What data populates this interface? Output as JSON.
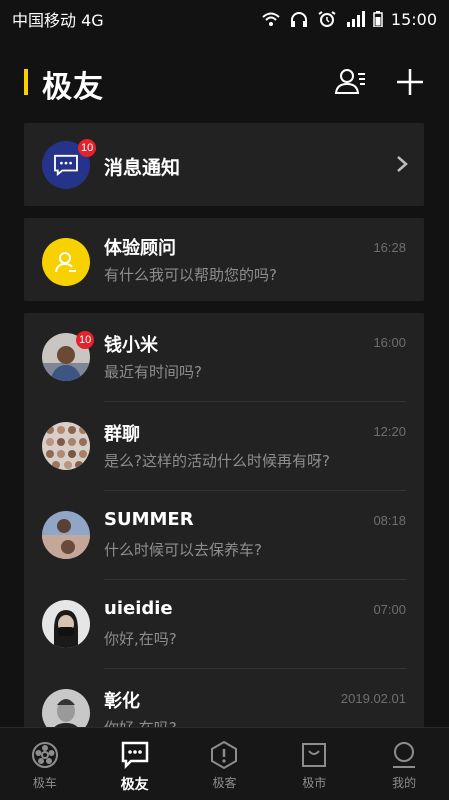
{
  "status_bar": {
    "carrier": "中国移动 4G",
    "time": "15:00"
  },
  "header": {
    "title": "极友",
    "accent_color": "#f7d100"
  },
  "notification": {
    "label": "消息通知",
    "badge": "10",
    "icon": "chat-bubble-icon"
  },
  "advisor": {
    "name": "体验顾问",
    "message": "有什么我可以帮助您的吗?",
    "time": "16:28",
    "icon": "person-icon"
  },
  "conversations": [
    {
      "name": "钱小米",
      "message": "最近有时间吗?",
      "time": "16:00",
      "badge": "10"
    },
    {
      "name": "群聊",
      "message": "是么?这样的活动什么时候再有呀?",
      "time": "12:20",
      "badge": ""
    },
    {
      "name": "SUMMER",
      "message": "什么时候可以去保养车?",
      "time": "08:18",
      "badge": ""
    },
    {
      "name": "uieidie",
      "message": "你好,在吗?",
      "time": "07:00",
      "badge": ""
    },
    {
      "name": "彰化",
      "message": "你好,在吗?",
      "time": "2019.02.01",
      "badge": ""
    }
  ],
  "tabs": [
    {
      "label": "极车",
      "icon": "wheel-icon",
      "active": false
    },
    {
      "label": "极友",
      "icon": "chat-icon",
      "active": true
    },
    {
      "label": "极客",
      "icon": "hexagon-icon",
      "active": false
    },
    {
      "label": "极市",
      "icon": "bag-icon",
      "active": false
    },
    {
      "label": "我的",
      "icon": "profile-icon",
      "active": false
    }
  ]
}
